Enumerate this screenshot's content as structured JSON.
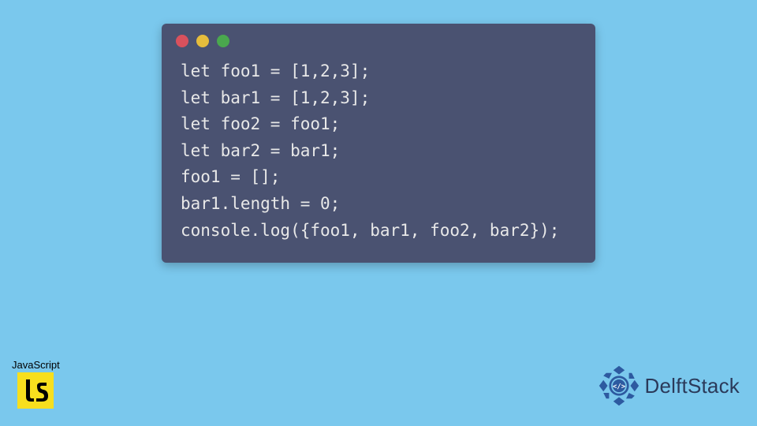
{
  "code": {
    "lines": [
      "let foo1 = [1,2,3];",
      "let bar1 = [1,2,3];",
      "let foo2 = foo1;",
      "let bar2 = bar1;",
      "foo1 = [];",
      "bar1.length = 0;",
      "console.log({foo1, bar1, foo2, bar2});"
    ]
  },
  "js_badge": {
    "label": "JavaScript",
    "logo_text": "JS"
  },
  "brand": {
    "name": "DelftStack"
  },
  "colors": {
    "background": "#7ac8ed",
    "window": "#4a5271",
    "js_yellow": "#f7df1e",
    "brand_blue": "#2d5aa0"
  }
}
